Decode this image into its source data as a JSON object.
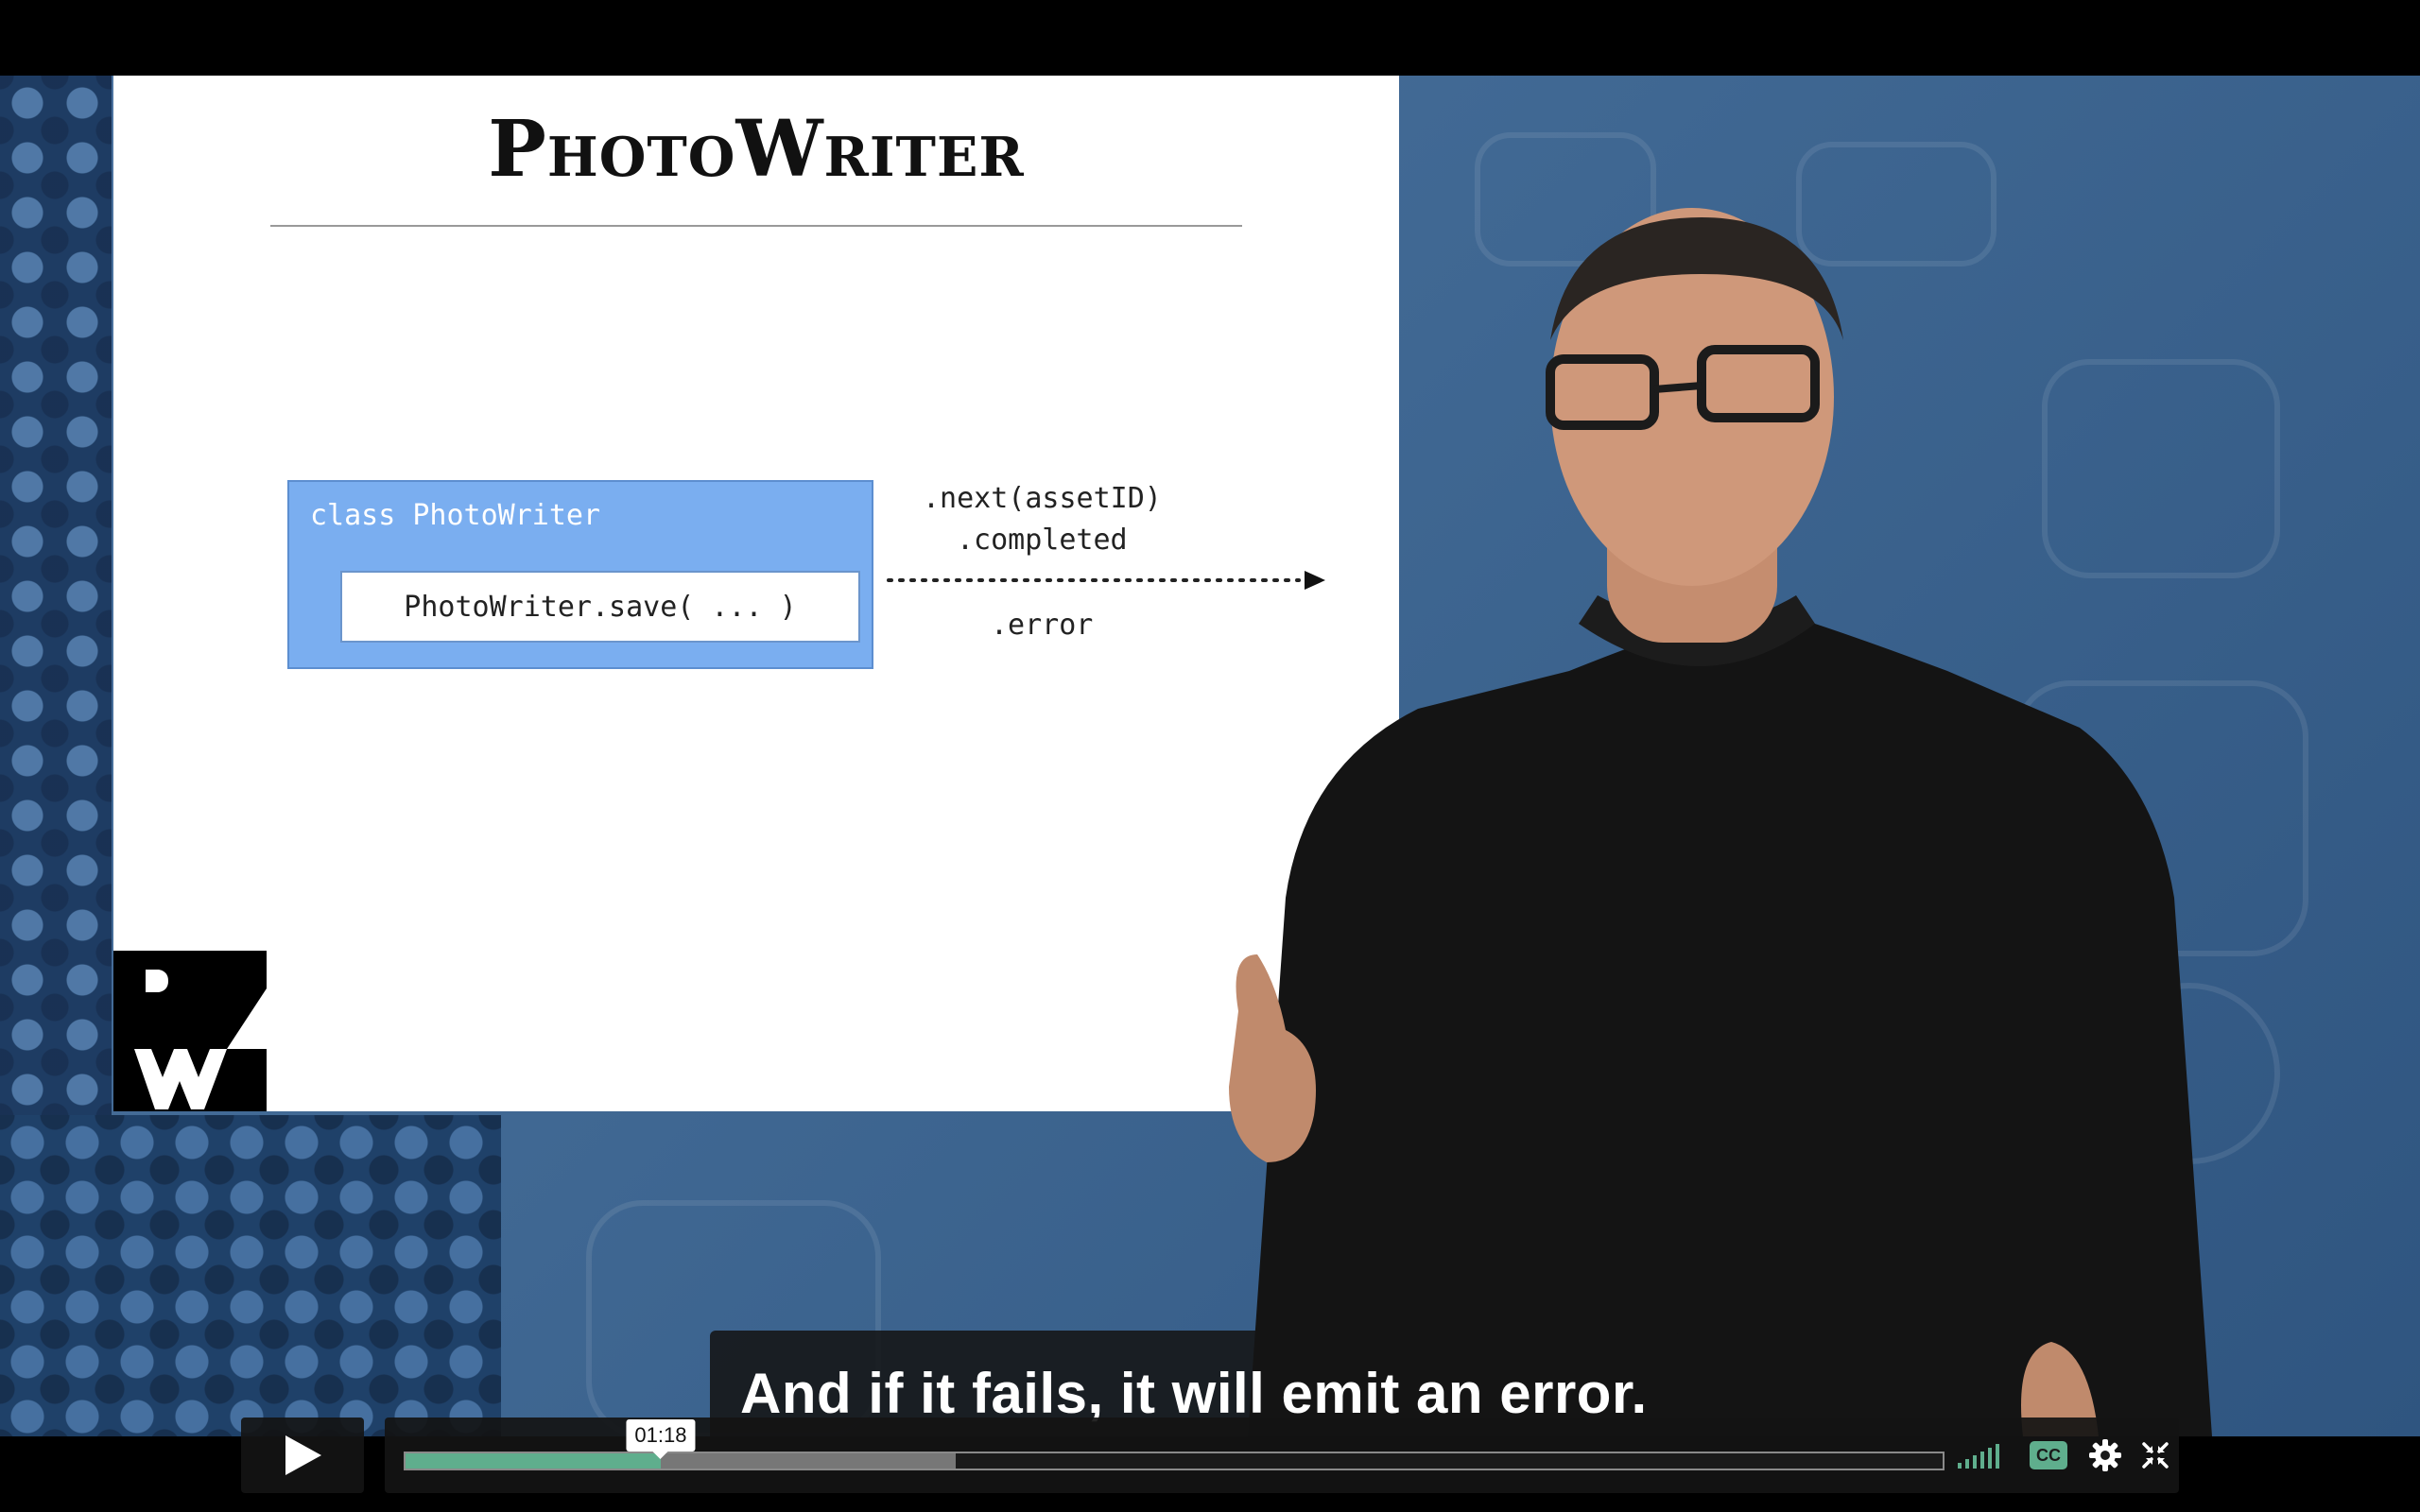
{
  "slide": {
    "title": "PhotoWriter",
    "class_label": "class PhotoWriter",
    "method_label": "PhotoWriter.save( ... )",
    "emit_next": ".next(assetID)",
    "emit_completed": ".completed",
    "emit_error": ".error"
  },
  "caption": {
    "text": "And if it fails, it will emit an error."
  },
  "player": {
    "current_time": "01:18",
    "played_fraction": 0.166,
    "buffered_fraction": 0.358,
    "controls": {
      "play_icon": "play-icon",
      "volume_icon": "volume-bars-icon",
      "cc_label": "CC",
      "settings_icon": "gear-icon",
      "fullscreen_icon": "exit-fullscreen-icon"
    },
    "accent_color": "#5fae8d"
  }
}
